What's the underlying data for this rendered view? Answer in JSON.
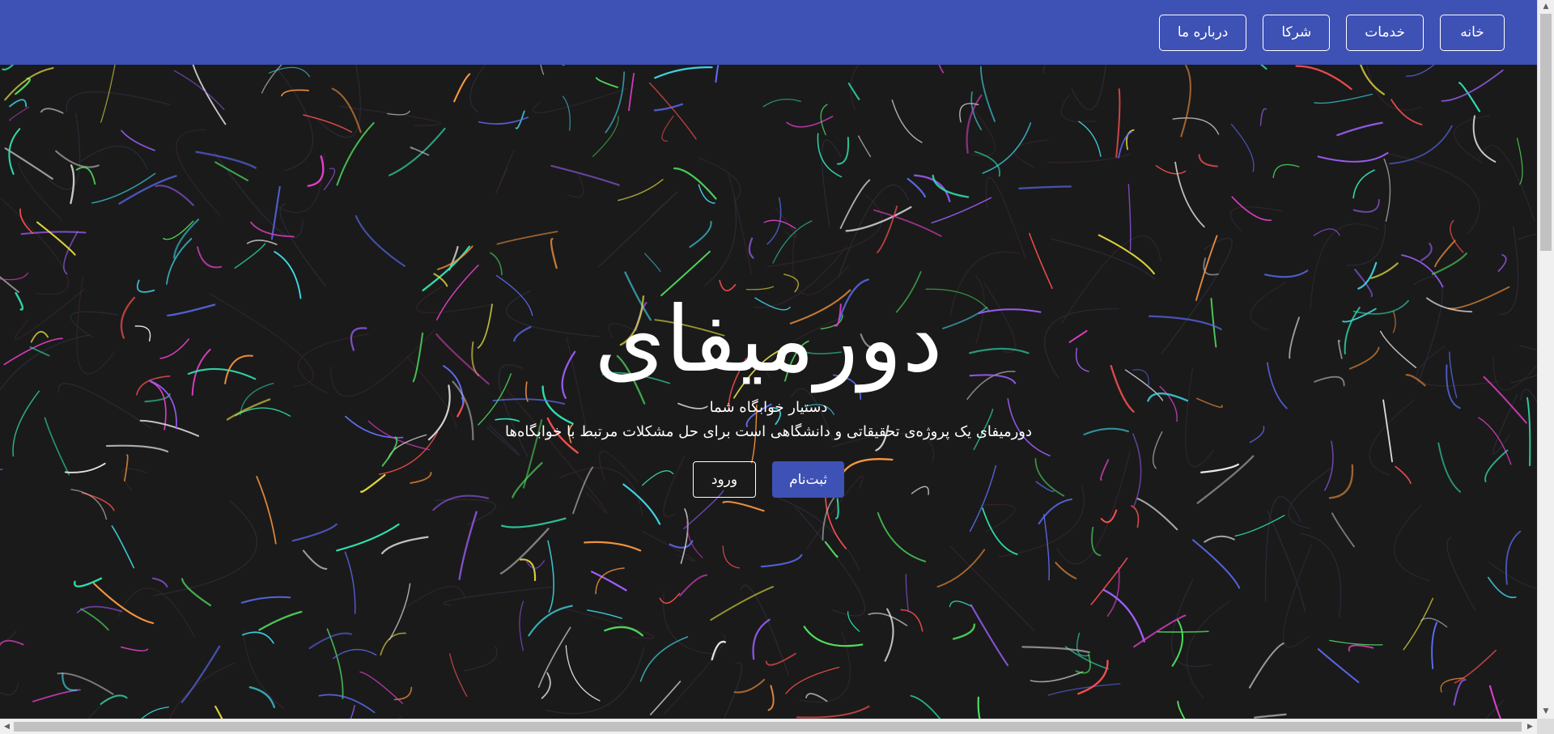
{
  "nav": {
    "items": [
      {
        "label": "خانه"
      },
      {
        "label": "خدمات"
      },
      {
        "label": "شرکا"
      },
      {
        "label": "درباره ما"
      }
    ]
  },
  "hero": {
    "title": "دورمیفای",
    "subtitle": "دستیار خوابگاه شما",
    "description": "دورمیفای یک پروژه‌ی تحقیقاتی و دانشگاهی است برای حل مشکلات مرتبط با خوابگاه‌ها",
    "signup_label": "ثبت‌نام",
    "login_label": "ورود"
  },
  "colors": {
    "brand": "#3e51b5",
    "background": "#1a1a1a",
    "text": "#ffffff"
  },
  "scrollbars": {
    "vertical_icons": [
      "scroll-up-arrow-icon",
      "scroll-down-arrow-icon"
    ],
    "horizontal_icons": [
      "scroll-left-arrow-icon",
      "scroll-right-arrow-icon"
    ]
  }
}
